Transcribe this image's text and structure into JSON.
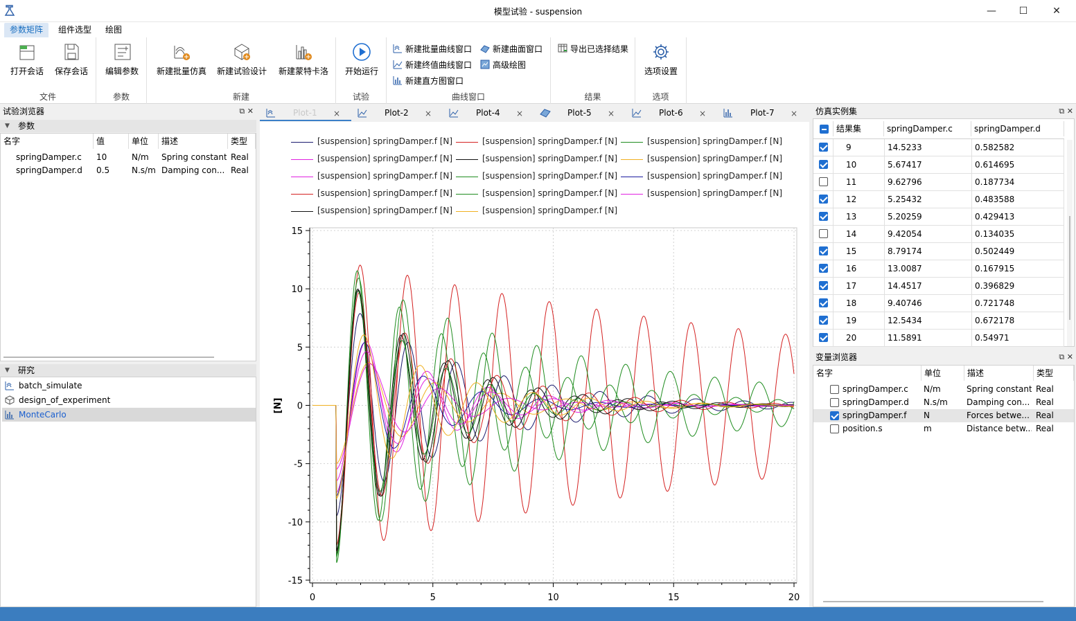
{
  "window": {
    "title": "模型试验 - suspension",
    "minimize": "—",
    "maximize": "☐",
    "close": "✕"
  },
  "menu": {
    "tabs": [
      "参数矩阵",
      "组件选型",
      "绘图"
    ]
  },
  "ribbon": {
    "file": {
      "label": "文件",
      "open": "打开会话",
      "save": "保存会话"
    },
    "params": {
      "label": "参数",
      "edit": "编辑参数"
    },
    "new": {
      "label": "新建",
      "batch": "新建批量仿真",
      "doe": "新建试验设计",
      "montecarlo": "新建蒙特卡洛"
    },
    "experiment": {
      "label": "试验",
      "run": "开始运行"
    },
    "curve": {
      "label": "曲线窗口",
      "batch_curve": "新建批量曲线窗口",
      "final_curve": "新建终值曲线窗口",
      "histogram": "新建直方图窗口",
      "surface": "新建曲面窗口",
      "advanced": "高级绘图"
    },
    "result": {
      "label": "结果",
      "export": "导出已选择结果"
    },
    "options": {
      "label": "选项",
      "settings": "选项设置"
    }
  },
  "experiment_browser": {
    "title": "试验浏览器",
    "params_section": "参数",
    "columns": [
      "名字",
      "值",
      "单位",
      "描述",
      "类型"
    ],
    "rows": [
      {
        "name": "springDamper.c",
        "value": "10",
        "unit": "N/m",
        "desc": "Spring constant",
        "type": "Real"
      },
      {
        "name": "springDamper.d",
        "value": "0.5",
        "unit": "N.s/m",
        "desc": "Damping con...",
        "type": "Real"
      }
    ],
    "study_section": "研究",
    "studies": [
      {
        "name": "batch_simulate",
        "icon": "batch-icon"
      },
      {
        "name": "design_of_experiment",
        "icon": "doe-icon"
      },
      {
        "name": "MonteCarlo",
        "icon": "histogram-icon",
        "selected": true
      }
    ]
  },
  "plot_tabs": [
    {
      "label": "Plot-1",
      "icon": "batch-plot-icon",
      "active": true
    },
    {
      "label": "Plot-2",
      "icon": "line-plot-icon"
    },
    {
      "label": "Plot-4",
      "icon": "line-plot-icon"
    },
    {
      "label": "Plot-5",
      "icon": "surface-plot-icon"
    },
    {
      "label": "Plot-6",
      "icon": "line-plot-icon"
    },
    {
      "label": "Plot-7",
      "icon": "histogram-plot-icon"
    }
  ],
  "tab_close": "×",
  "chart_data": {
    "type": "line",
    "ylabel": "[N]",
    "xlabel": "",
    "xlim": [
      0,
      20
    ],
    "ylim": [
      -15,
      15
    ],
    "xticks": [
      0,
      5,
      10,
      15,
      20
    ],
    "yticks": [
      15,
      10,
      5,
      0,
      -5,
      -10,
      -15
    ],
    "grid": true,
    "legend_position": "top",
    "series": [
      {
        "name": "[suspension] springDamper.f [N]",
        "color": "#1a1a6e",
        "amp": 9.5,
        "omega": 3.16,
        "zeta": 0.06
      },
      {
        "name": "[suspension] springDamper.f [N]",
        "color": "#d42020",
        "amp": 12.5,
        "omega": 3.2,
        "zeta": 0.012
      },
      {
        "name": "[suspension] springDamper.f [N]",
        "color": "#1e8c1e",
        "amp": 13.5,
        "omega": 3.6,
        "zeta": 0.05
      },
      {
        "name": "[suspension] springDamper.f [N]",
        "color": "#e020e0",
        "amp": 7.5,
        "omega": 2.5,
        "zeta": 0.1
      },
      {
        "name": "[suspension] springDamper.f [N]",
        "color": "#111111",
        "amp": 12.8,
        "omega": 3.5,
        "zeta": 0.08
      },
      {
        "name": "[suspension] springDamper.f [N]",
        "color": "#f0b020",
        "amp": 5.0,
        "omega": 2.3,
        "zeta": 0.1
      },
      {
        "name": "[suspension] springDamper.f [N]",
        "color": "#e020e0",
        "amp": 5.5,
        "omega": 2.2,
        "zeta": 0.14
      },
      {
        "name": "[suspension] springDamper.f [N]",
        "color": "#1e8c1e",
        "amp": 12.0,
        "omega": 3.4,
        "zeta": 0.03
      },
      {
        "name": "[suspension] springDamper.f [N]",
        "color": "#1a1a9e",
        "amp": 7.8,
        "omega": 2.6,
        "zeta": 0.12
      },
      {
        "name": "[suspension] springDamper.f [N]",
        "color": "#d42020",
        "amp": 12.0,
        "omega": 3.3,
        "zeta": 0.07
      },
      {
        "name": "[suspension] springDamper.f [N]",
        "color": "#1e8c1e",
        "amp": 13.0,
        "omega": 3.45,
        "zeta": 0.09
      },
      {
        "name": "[suspension] springDamper.f [N]",
        "color": "#e020e0",
        "amp": 6.5,
        "omega": 2.45,
        "zeta": 0.11
      },
      {
        "name": "[suspension] springDamper.f [N]",
        "color": "#111111",
        "amp": 12.5,
        "omega": 3.38,
        "zeta": 0.075
      },
      {
        "name": "[suspension] springDamper.f [N]",
        "color": "#f0b020",
        "amp": 8.0,
        "omega": 2.7,
        "zeta": 0.09
      }
    ],
    "x_start": 1.0
  },
  "sim_set": {
    "title": "仿真实例集",
    "columns": [
      "结果集",
      "springDamper.c",
      "springDamper.d"
    ],
    "rows": [
      {
        "id": "9",
        "c": "14.5233",
        "d": "0.582582",
        "checked": true
      },
      {
        "id": "10",
        "c": "5.67417",
        "d": "0.614695",
        "checked": true
      },
      {
        "id": "11",
        "c": "9.62796",
        "d": "0.187734",
        "checked": false
      },
      {
        "id": "12",
        "c": "5.25432",
        "d": "0.483588",
        "checked": true
      },
      {
        "id": "13",
        "c": "5.20259",
        "d": "0.429413",
        "checked": true
      },
      {
        "id": "14",
        "c": "9.42054",
        "d": "0.134035",
        "checked": false
      },
      {
        "id": "15",
        "c": "8.79174",
        "d": "0.502449",
        "checked": true
      },
      {
        "id": "16",
        "c": "13.0087",
        "d": "0.167915",
        "checked": true
      },
      {
        "id": "17",
        "c": "14.4517",
        "d": "0.396829",
        "checked": true
      },
      {
        "id": "18",
        "c": "9.40746",
        "d": "0.721748",
        "checked": true
      },
      {
        "id": "19",
        "c": "12.5434",
        "d": "0.672178",
        "checked": true
      },
      {
        "id": "20",
        "c": "11.5891",
        "d": "0.54971",
        "checked": true
      }
    ]
  },
  "var_browser": {
    "title": "变量浏览器",
    "columns": [
      "名字",
      "单位",
      "描述",
      "类型"
    ],
    "rows": [
      {
        "name": "springDamper.c",
        "unit": "N/m",
        "desc": "Spring constant",
        "type": "Real",
        "checked": false
      },
      {
        "name": "springDamper.d",
        "unit": "N.s/m",
        "desc": "Damping con...",
        "type": "Real",
        "checked": false
      },
      {
        "name": "springDamper.f",
        "unit": "N",
        "desc": "Forces betwe...",
        "type": "Real",
        "checked": true
      },
      {
        "name": "position.s",
        "unit": "m",
        "desc": "Distance betw...",
        "type": "Real",
        "checked": false
      }
    ]
  },
  "panel_buttons": "⧉ ✕"
}
